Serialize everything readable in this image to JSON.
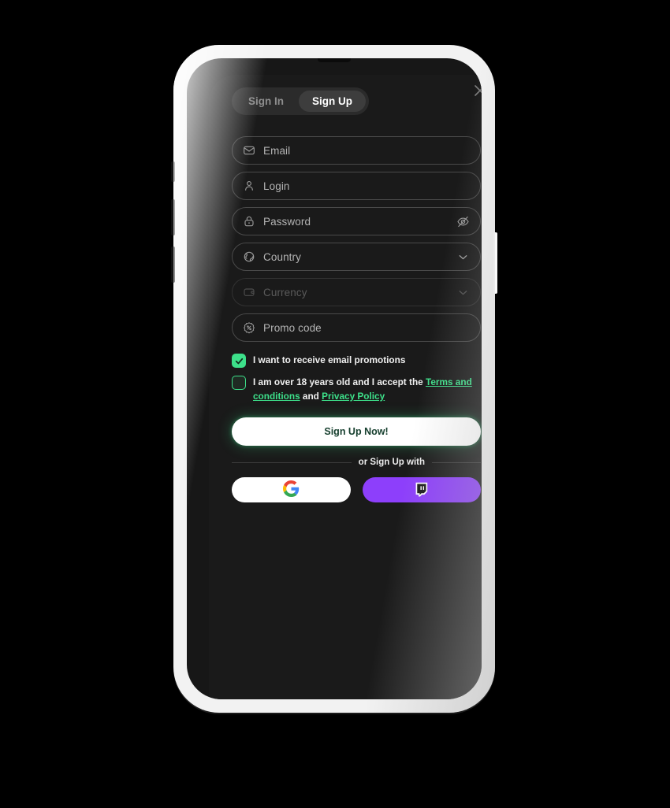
{
  "device": {
    "type": "smartphone-mockup",
    "buttons": [
      "mute-switch",
      "volume-up",
      "volume-down",
      "power"
    ]
  },
  "modal": {
    "tabs": [
      {
        "id": "sign-in",
        "label": "Sign In",
        "active": false
      },
      {
        "id": "sign-up",
        "label": "Sign Up",
        "active": true
      }
    ],
    "close_label": "Close",
    "close_icon": "close-icon",
    "fields": [
      {
        "id": "email",
        "placeholder": "Email",
        "value": "",
        "icon": "envelope-icon",
        "trailing": null,
        "disabled": false
      },
      {
        "id": "login",
        "placeholder": "Login",
        "value": "",
        "icon": "user-icon",
        "trailing": null,
        "disabled": false
      },
      {
        "id": "password",
        "placeholder": "Password",
        "value": "",
        "icon": "lock-icon",
        "trailing": "eye-off-icon",
        "disabled": false
      },
      {
        "id": "country",
        "placeholder": "Country",
        "value": "",
        "icon": "globe-icon",
        "trailing": "chevron-down-icon",
        "disabled": false
      },
      {
        "id": "currency",
        "placeholder": "Currency",
        "value": "",
        "icon": "wallet-icon",
        "trailing": "chevron-down-icon",
        "disabled": true
      },
      {
        "id": "promo",
        "placeholder": "Promo code",
        "value": "",
        "icon": "discount-badge-icon",
        "trailing": null,
        "disabled": false
      }
    ],
    "checkboxes": [
      {
        "id": "email-promotions",
        "checked": true,
        "text": "I want to receive email promotions",
        "links": []
      },
      {
        "id": "age-terms",
        "checked": false,
        "text_before": "I am over 18 years old and I accept the ",
        "link1": "Terms and conditions",
        "text_middle": " and ",
        "link2": "Privacy Policy",
        "text_after": ""
      }
    ],
    "submit_label": "Sign Up Now!",
    "divider_label": "or Sign Up with",
    "social_buttons": [
      {
        "id": "google",
        "icon": "google-icon",
        "label": "Google",
        "bg": "#ffffff"
      },
      {
        "id": "twitch",
        "icon": "twitch-icon",
        "label": "Twitch",
        "bg": "#8d3ffb"
      }
    ]
  },
  "colors": {
    "page_background": "#000000",
    "phone_frame": "#f2f2f2",
    "screen_background": "#171717",
    "modal_background": "#1a1a1a",
    "accent_green": "#3de08a",
    "twitch_purple": "#8d3ffb",
    "submit_text": "#17402f",
    "tab_active_background": "#3d3d3d",
    "tab_group_background": "#2b2b2b",
    "field_border": "#4a4a4a",
    "field_border_disabled": "#323232"
  }
}
